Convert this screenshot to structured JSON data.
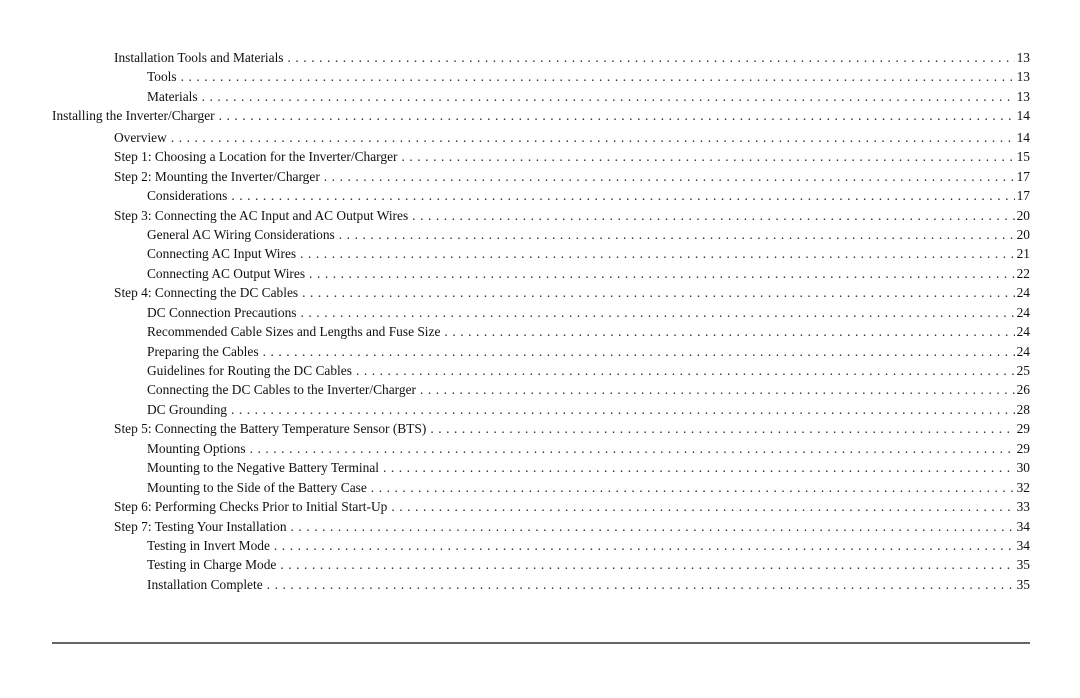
{
  "toc": [
    {
      "title": "Installation Tools and Materials",
      "page": "13",
      "level": 1
    },
    {
      "title": "Tools",
      "page": "13",
      "level": 2
    },
    {
      "title": "Materials",
      "page": "13",
      "level": 2
    },
    {
      "title": "Installing the Inverter/Charger",
      "page": "14",
      "level": 0
    },
    {
      "title": "Overview",
      "page": "14",
      "level": 1
    },
    {
      "title": "Step 1: Choosing a Location for the Inverter/Charger",
      "page": "15",
      "level": 1
    },
    {
      "title": "Step 2: Mounting the Inverter/Charger",
      "page": "17",
      "level": 1
    },
    {
      "title": "Considerations",
      "page": "17",
      "level": 2
    },
    {
      "title": "Step 3: Connecting the AC Input and AC Output Wires",
      "page": "20",
      "level": 1
    },
    {
      "title": "General AC Wiring Considerations",
      "page": "20",
      "level": 2
    },
    {
      "title": "Connecting AC Input Wires",
      "page": "21",
      "level": 2
    },
    {
      "title": "Connecting AC Output Wires",
      "page": "22",
      "level": 2
    },
    {
      "title": "Step 4: Connecting the DC Cables",
      "page": "24",
      "level": 1
    },
    {
      "title": "DC Connection Precautions",
      "page": "24",
      "level": 2
    },
    {
      "title": "Recommended Cable Sizes and Lengths and Fuse Size",
      "page": "24",
      "level": 2
    },
    {
      "title": "Preparing the Cables",
      "page": "24",
      "level": 2
    },
    {
      "title": "Guidelines for Routing the DC Cables",
      "page": "25",
      "level": 2
    },
    {
      "title": "Connecting the DC Cables to the Inverter/Charger",
      "page": "26",
      "level": 2
    },
    {
      "title": "DC Grounding",
      "page": "28",
      "level": 2
    },
    {
      "title": "Step 5: Connecting the Battery Temperature Sensor (BTS)",
      "page": "29",
      "level": 1
    },
    {
      "title": "Mounting Options",
      "page": "29",
      "level": 2
    },
    {
      "title": "Mounting to the Negative Battery Terminal",
      "page": "30",
      "level": 2
    },
    {
      "title": "Mounting to the Side of the Battery Case",
      "page": "32",
      "level": 2
    },
    {
      "title": "Step 6: Performing Checks Prior to Initial Start-Up",
      "page": "33",
      "level": 1
    },
    {
      "title": "Step 7: Testing Your Installation",
      "page": "34",
      "level": 1
    },
    {
      "title": "Testing in Invert Mode",
      "page": "34",
      "level": 2
    },
    {
      "title": "Testing in Charge Mode",
      "page": "35",
      "level": 2
    },
    {
      "title": "Installation Complete",
      "page": "35",
      "level": 2
    }
  ]
}
